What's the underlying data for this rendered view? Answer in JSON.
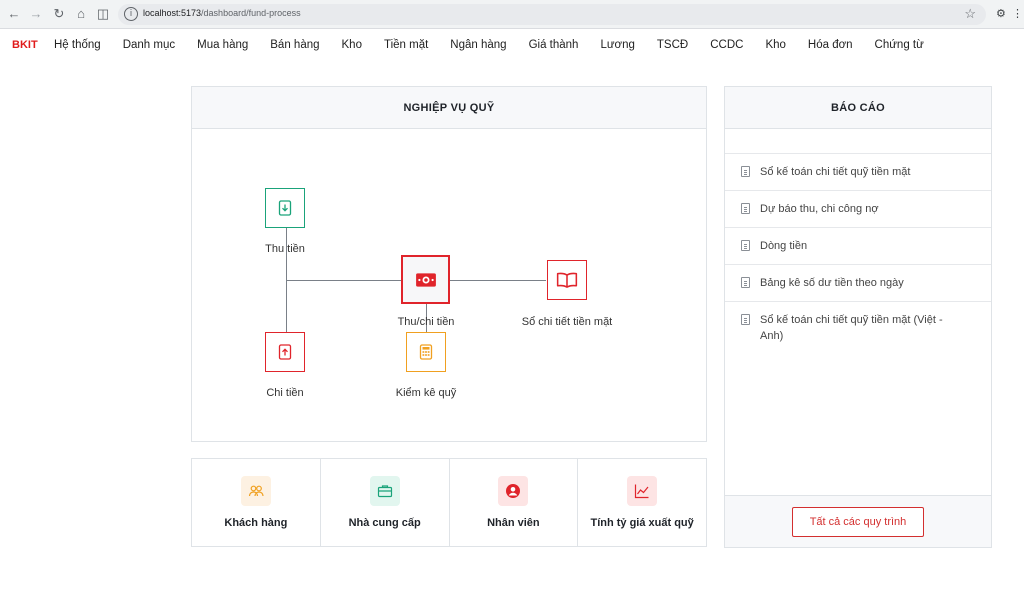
{
  "browser": {
    "url_host": "localhost:5173",
    "url_path": "/dashboard/fund-process"
  },
  "app": {
    "brand": "BKIT",
    "menu": [
      "Hệ thống",
      "Danh mục",
      "Mua hàng",
      "Bán hàng",
      "Kho",
      "Tiền mặt",
      "Ngân hàng",
      "Giá thành",
      "Lương",
      "TSCĐ",
      "CCDC",
      "Kho",
      "Hóa đơn",
      "Chứng từ"
    ]
  },
  "process": {
    "title": "NGHIỆP VỤ QUỸ",
    "nodes": {
      "receipt": "Thu tiền",
      "payment": "Chi tiền",
      "receipt_payment": "Thu/chi tiền",
      "cash_ledger": "Sổ chi tiết tiền mặt",
      "fund_count": "Kiểm kê quỹ"
    },
    "colors": {
      "green": "#1aa37a",
      "red": "#e0242b",
      "orange": "#f0a020",
      "line": "#7a8088"
    }
  },
  "cards": [
    {
      "label": "Khách hàng",
      "icon": "users-icon",
      "bg": "#fdf1e2",
      "color": "#f0a020"
    },
    {
      "label": "Nhà cung cấp",
      "icon": "briefcase-icon",
      "bg": "#e2f6ef",
      "color": "#1aa37a"
    },
    {
      "label": "Nhân viên",
      "icon": "user-circle-icon",
      "bg": "#fde4e4",
      "color": "#e0242b"
    },
    {
      "label": "Tính tỷ giá xuất quỹ",
      "icon": "chart-line-icon",
      "bg": "#fde4e4",
      "color": "#e0242b"
    }
  ],
  "reports": {
    "title": "BÁO CÁO",
    "items": [
      "Sổ kế toán chi tiết quỹ tiền mặt",
      "Dự báo thu, chi công nợ",
      "Dòng tiền",
      "Bảng kê số dư tiền theo ngày",
      "Sổ kế toán chi tiết quỹ tiền mặt (Việt - Anh)"
    ],
    "all_button": "Tất cả các quy trình"
  }
}
